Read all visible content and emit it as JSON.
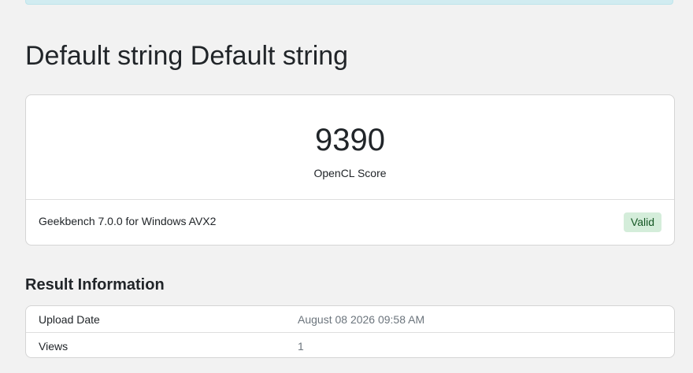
{
  "page": {
    "title": "Default string Default string"
  },
  "score": {
    "value": "9390",
    "label": "OpenCL Score",
    "version": "Geekbench 7.0.0 for Windows AVX2",
    "status": "Valid"
  },
  "result_information": {
    "title": "Result Information",
    "rows": [
      {
        "name": "Upload Date",
        "value": "August 08 2026 09:58 AM"
      },
      {
        "name": "Views",
        "value": "1"
      }
    ]
  },
  "colors": {
    "alert_background": "#d1ecf1",
    "valid_badge_background": "#d4edda",
    "valid_badge_text": "#155724",
    "muted_text": "#6c757d"
  }
}
